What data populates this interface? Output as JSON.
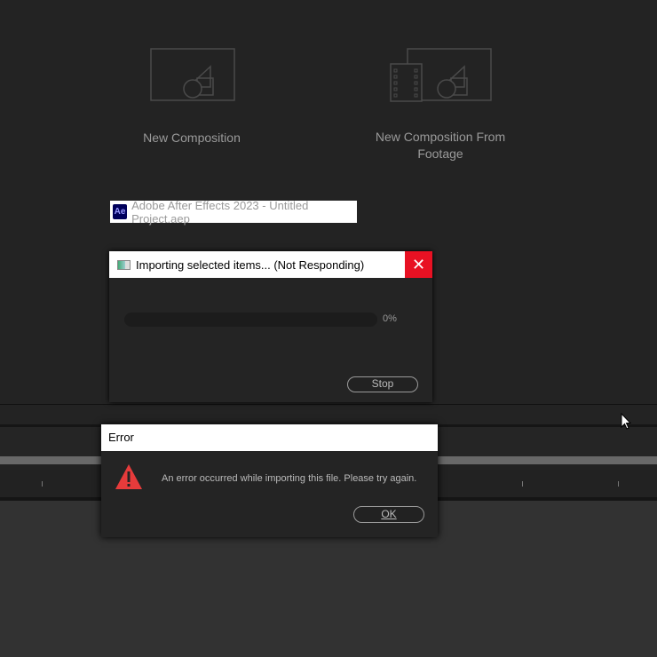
{
  "home": {
    "new_composition": "New Composition",
    "new_composition_footage": "New Composition From Footage"
  },
  "app_title": {
    "icon": "Ae",
    "text": "Adobe After Effects 2023 - Untitled Project.aep"
  },
  "import_dialog": {
    "title": "Importing selected items... (Not Responding)",
    "progress_percent": 0,
    "progress_label": "0%",
    "stop_label": "Stop"
  },
  "error_dialog": {
    "title": "Error",
    "message": "An error occurred while importing this file. Please try again.",
    "ok_label": "OK"
  },
  "colors": {
    "error_red": "#e81123",
    "warning": "#e63b3b"
  }
}
